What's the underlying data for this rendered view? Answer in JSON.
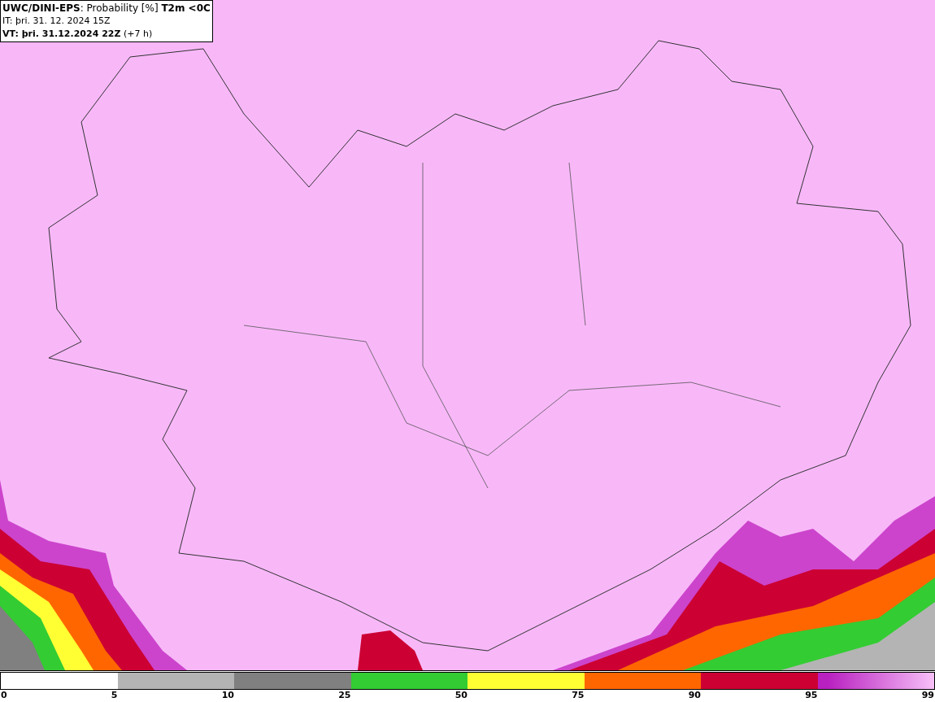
{
  "header": {
    "lines": [
      "**UWC/DINI-EPS**: Probability [%] **T2m <0C**",
      "IT: þri. 31. 12. 2024 15Z",
      "**VT: þri. 31.12.2024 22Z** (+7 h)"
    ]
  },
  "legend": {
    "segments": [
      {
        "kind": "solid",
        "color": "#ffffff"
      },
      {
        "kind": "solid",
        "color": "#b4b4b4"
      },
      {
        "kind": "solid",
        "color": "#808080"
      },
      {
        "kind": "solid",
        "color": "#33cc33"
      },
      {
        "kind": "solid",
        "color": "#ffff33"
      },
      {
        "kind": "solid",
        "color": "#ff6600"
      },
      {
        "kind": "solid",
        "color": "#cc0033"
      },
      {
        "kind": "gradient",
        "color": "#b820c0"
      }
    ],
    "ticks": [
      "0",
      "5",
      "10",
      "25",
      "50",
      "75",
      "90",
      "95",
      "99"
    ]
  }
}
